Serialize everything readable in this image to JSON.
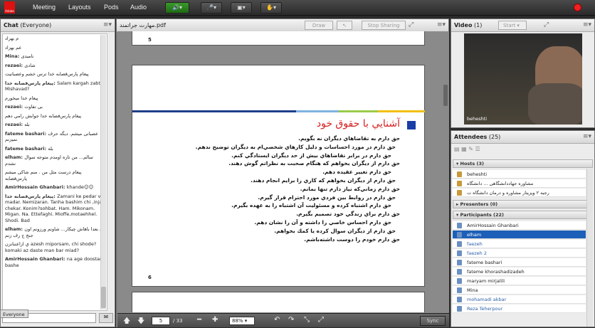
{
  "topbar": {
    "menu": [
      "Meeting",
      "Layouts",
      "Pods",
      "Audio"
    ],
    "logo_text": "Adobe"
  },
  "chat": {
    "title": "Chat",
    "scope": "(Everyone)",
    "tab": "Everyone",
    "messages": [
      {
        "name": "",
        "text": "م بهزاد"
      },
      {
        "name": "",
        "text": "عم بهزاد"
      },
      {
        "name": "Mina:",
        "text": "نامیدی"
      },
      {
        "name": "rezaei:",
        "text": "شادی"
      },
      {
        "name": "",
        "text": "ترس خشم وعصبانیت ‪پیغام پارس‌قصابه خدا‬"
      },
      {
        "name": "‪پیغام پارس‌قصابه خدا‬:",
        "text": "Salam kargah zabt. Mishavad?"
      },
      {
        "name": "",
        "text": "خدا میخورم ‪پیغام‬"
      },
      {
        "name": "rezaei:",
        "text": "بی تفاوت"
      },
      {
        "name": "",
        "text": "جوابش رامي دهم ‪پیغام پارس‌قصابه خدا‬"
      },
      {
        "name": "rezaei:",
        "text": "بله"
      },
      {
        "name": "fateme bashari:",
        "text": "عصبانی میشم. دیگه حرف نمیزنم"
      },
      {
        "name": "fateme bashari:",
        "text": "بله"
      },
      {
        "name": "elham:",
        "text": "سالم... من تازه اومدم متوجه سوال نشدم"
      },
      {
        "name": "",
        "text": "درست مثل من . منم شاکی میشم ‪پیغام پارس‌قصابه‬"
      },
      {
        "name": "AmirHossain Ghanbari:",
        "text": "khande☺☺"
      },
      {
        "name": "‪پیغام پارس‌قصابه خدا‬:",
        "text": "Zamani ke pedar va madar. Nemizaran. Tanha bashim chi ,inja chekar. Konim?sohbat. Ham. Mikonam. Migan. Na. Ettefaghi. Mioffe,motaehhel. Shodi. Bad"
      },
      {
        "name": "elham:",
        "text": "د بعدا باهاش چیکار...  شاونم ورزونم اون جنج ج رف زنم"
      },
      {
        "name": "",
        "text": "ي ازاعتنانزن azesh miporsam, chi shode? komaki az daste man bar miad?"
      },
      {
        "name": "AmirHossain Ghanbari:",
        "text": "na age doostam bashe"
      }
    ]
  },
  "share": {
    "filename": "مهارت جراتمند.pdf",
    "draw": "Draw",
    "stop": "Stop Sharing"
  },
  "slide": {
    "page_top": "5",
    "page_bottom": "6",
    "title": "آشنايي با حقوق خود",
    "lines": [
      "حق دارم به تقاضاهاي ديگران نه بگويم.",
      "حق دارم در مورد احساسات و دليل كارهاي شخصي‌ام به ديگران توضيح ندهم.",
      "حق دارم در برابر تقاضاهاي بيش از حد ديگران ايستادگي كنم.",
      "حق دارم از ديگران بخواهم كه هنگام صحبت به نظراتم گوش دهند.",
      "حق دارم تغيير عقيده دهم.",
      "حق دارم از ديگران بخواهم كه كاري را برايم انجام دهند.",
      "حق دارم زماني‌كه نياز دارم تنها بمانم.",
      "حق دارم در روابط بين فردي مورد احترام قرار گيرم.",
      "حق دارم اشتباه كرده و مسئوليت آن اشتباه را به عهده بگيرم.",
      "حق دارم  براي زندگي خود تصميم بگيرم.",
      "حق دارم احساس خاصي را داشته و آن را نشان دهم.",
      "حق دارم از ديگران سوال كرده يا كمك بخواهم.",
      "حق دارم خودم را دوست داشته‌باشم."
    ]
  },
  "toolbar": {
    "page": "5",
    "total": "/ 33",
    "zoom": "88%",
    "sync": "Sync"
  },
  "video": {
    "title": "Video",
    "count": "(1)",
    "start": "Start",
    "name": "beheshti"
  },
  "attendees": {
    "title": "Attendees",
    "count": "(25)",
    "hosts_label": "Hosts (3)",
    "presenters_label": "Presenters (0)",
    "participants_label": "Participants (22)",
    "hosts": [
      "beheshti",
      "مشاوره جهاد‌دانشگاهی ... دانشگاه",
      "رجبه ۲ ویزیتار مشاوره و درمان دانشگاه ت"
    ],
    "participants": [
      "AmirHossain Ghanbari",
      "elham",
      "faezeh",
      "faezeh 2",
      "fateme bashari",
      "fateme khorashadizadeh",
      "maryam mirjalili",
      "Mina",
      "mohamadi akbar",
      "Reza Teherpour"
    ]
  }
}
